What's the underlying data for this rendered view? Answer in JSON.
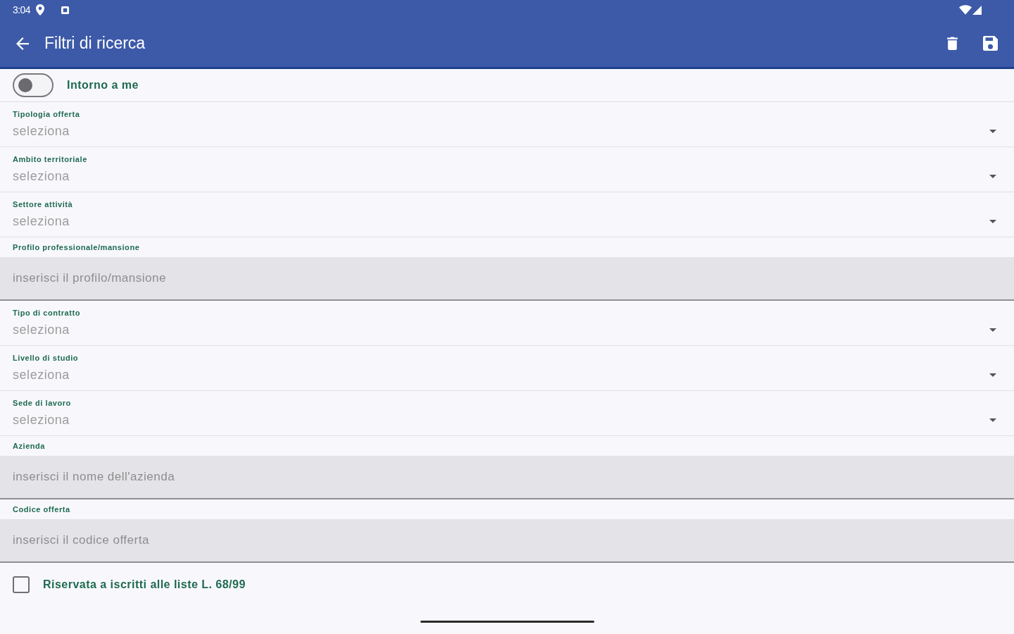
{
  "status_bar": {
    "time": "3:04"
  },
  "app_bar": {
    "title": "Filtri di ricerca"
  },
  "toggle": {
    "label": "Intorno a me",
    "on": false
  },
  "fields": [
    {
      "kind": "select",
      "label": "Tipologia offerta",
      "placeholder": "seleziona"
    },
    {
      "kind": "select",
      "label": "Ambito territoriale",
      "placeholder": "seleziona"
    },
    {
      "kind": "select",
      "label": "Settore attività",
      "placeholder": "seleziona"
    },
    {
      "kind": "text",
      "label": "Profilo professionale/mansione",
      "placeholder": "inserisci il profilo/mansione"
    },
    {
      "kind": "select",
      "label": "Tipo di contratto",
      "placeholder": "seleziona"
    },
    {
      "kind": "select",
      "label": "Livello di studio",
      "placeholder": "seleziona"
    },
    {
      "kind": "select",
      "label": "Sede di lavoro",
      "placeholder": "seleziona"
    },
    {
      "kind": "text",
      "label": "Azienda",
      "placeholder": "inserisci il nome dell'azienda"
    },
    {
      "kind": "text",
      "label": "Codice offerta",
      "placeholder": "inserisci il codice offerta"
    }
  ],
  "checkbox": {
    "label": "Riservata a iscritti alle liste L. 68/99",
    "checked": false
  }
}
